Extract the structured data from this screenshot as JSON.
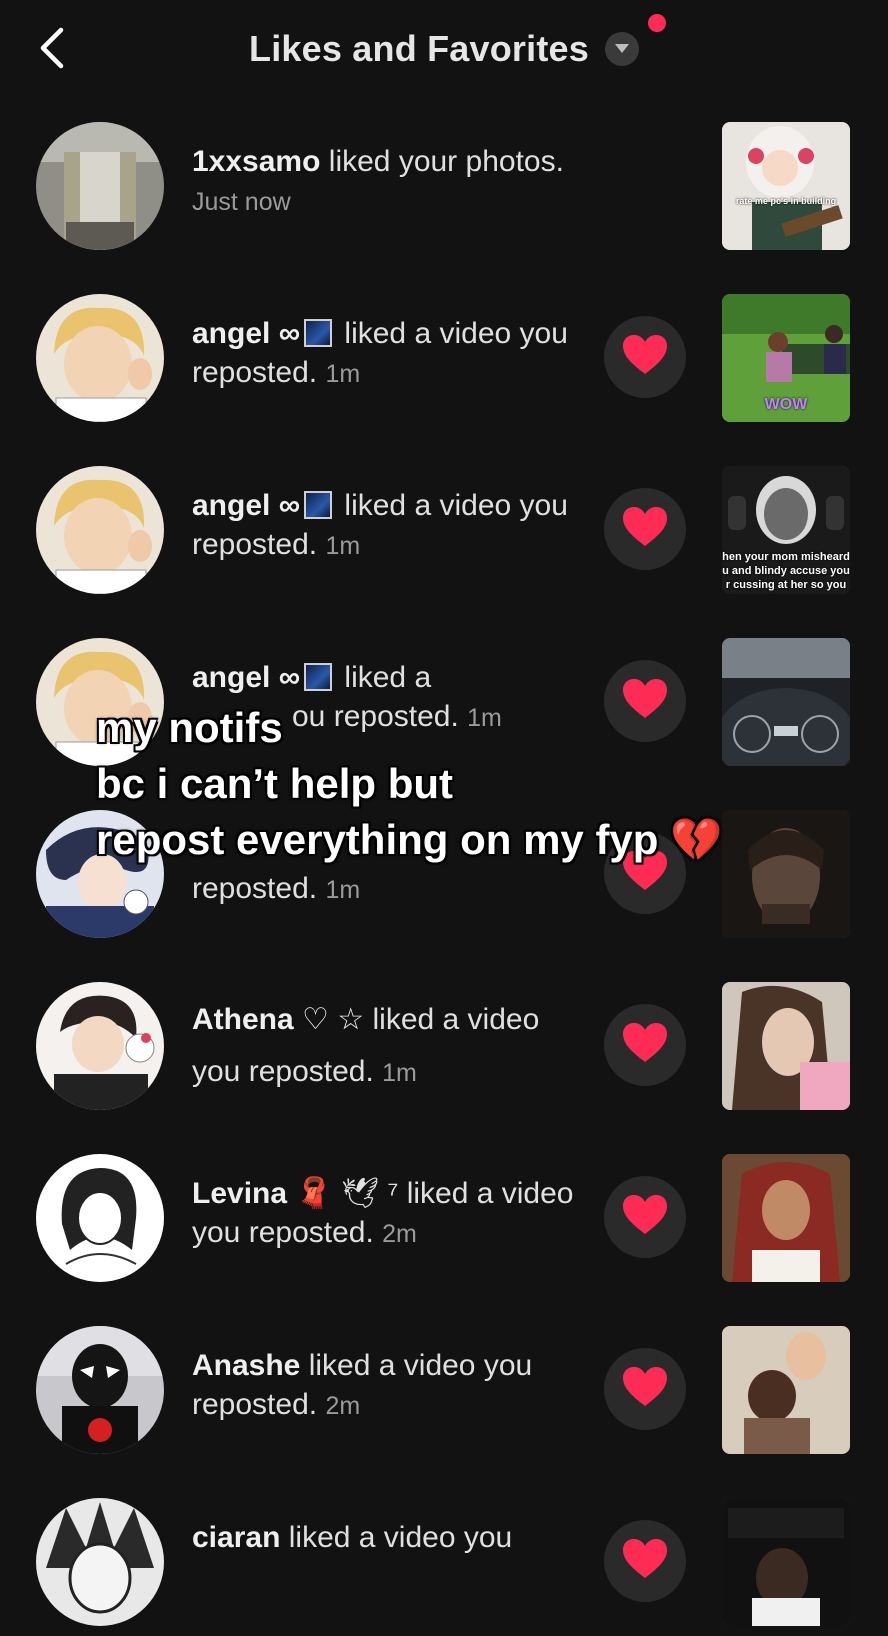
{
  "header": {
    "title": "Likes and Favorites",
    "back_icon": "chevron-left-icon",
    "caret_icon": "caret-down-icon",
    "notification_dot_color": "#fe2c55"
  },
  "notifications": [
    {
      "username": "1xxsamo",
      "action": "liked your photos.",
      "time": "Just now",
      "has_heart": false,
      "thumb_caption": "rate me pc's in building"
    },
    {
      "username": "angel ∞",
      "action": "liked a video you reposted.",
      "time": "1m",
      "has_heart": true,
      "thumb_caption": "WOW"
    },
    {
      "username": "angel ∞",
      "action": "liked a video you reposted.",
      "time": "1m",
      "has_heart": true,
      "thumb_caption": "hen your mom misheard\nu and blindy accuse you\nr cussing at her so you"
    },
    {
      "username": "angel ∞",
      "action": "liked a",
      "action_line2": "ou reposted.",
      "time": "1m",
      "has_heart": true,
      "thumb_caption": ""
    },
    {
      "username": "",
      "action": "reposted.",
      "time": "1m",
      "has_heart": true,
      "thumb_caption": ""
    },
    {
      "username": "Athena ♡ ☆",
      "action": "liked a video you reposted.",
      "time": "1m",
      "has_heart": true,
      "thumb_caption": ""
    },
    {
      "username": "Levina",
      "username_suffix": "🧣 🕊 ⁷",
      "action": "liked a video you reposted.",
      "time": "2m",
      "has_heart": true,
      "thumb_caption": ""
    },
    {
      "username": "Anashe",
      "action": "liked a video you reposted.",
      "time": "2m",
      "has_heart": true,
      "thumb_caption": ""
    },
    {
      "username": "ciaran",
      "action": "liked a video you",
      "time": "",
      "has_heart": true,
      "thumb_caption": ""
    }
  ],
  "overlay": {
    "text": "my notifs\nbc i can’t help but\nrepost everything on my fyp 💔"
  },
  "colors": {
    "background": "#121212",
    "heart": "#fe2c55",
    "heart_button_bg": "#2a2a2a",
    "muted_text": "#9a9a9a"
  }
}
